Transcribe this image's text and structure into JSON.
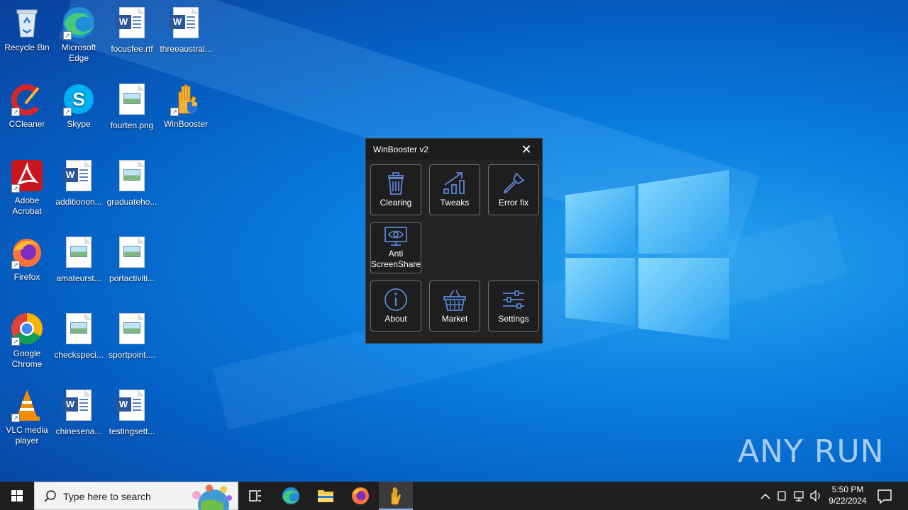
{
  "desktop_icons": [
    {
      "label": "Recycle Bin"
    },
    {
      "label": "Microsoft Edge"
    },
    {
      "label": "focusfee.rtf"
    },
    {
      "label": "threeaustral..."
    },
    {
      "label": "CCleaner"
    },
    {
      "label": "Skype"
    },
    {
      "label": "fourten.png"
    },
    {
      "label": "WinBooster"
    },
    {
      "label": "Adobe Acrobat"
    },
    {
      "label": "additionon..."
    },
    {
      "label": "graduateho..."
    },
    {
      "label": "Firefox"
    },
    {
      "label": "amateurst..."
    },
    {
      "label": "portactiviti..."
    },
    {
      "label": "Google Chrome"
    },
    {
      "label": "checkspeci..."
    },
    {
      "label": "sportpoint...."
    },
    {
      "label": "VLC media player"
    },
    {
      "label": "chinesena..."
    },
    {
      "label": "testingsett..."
    }
  ],
  "app_window": {
    "title": "WinBooster v2",
    "close_glyph": "✕",
    "tiles": [
      {
        "label": "Clearing",
        "icon": "trash-icon"
      },
      {
        "label": "Tweaks",
        "icon": "chart-arrow-icon"
      },
      {
        "label": "Error fix",
        "icon": "screwdriver-icon"
      },
      {
        "label": "Anti ScreenShare",
        "icon": "eye-monitor-icon"
      },
      {
        "label": "About",
        "icon": "info-icon"
      },
      {
        "label": "Market",
        "icon": "basket-icon"
      },
      {
        "label": "Settings",
        "icon": "sliders-icon"
      }
    ]
  },
  "watermark": "ANY RUN",
  "taskbar": {
    "search_placeholder": "Type here to search",
    "time": "5:50 PM",
    "date": "9/22/2024"
  },
  "colors": {
    "taskbar_bg": "#1f1f1f",
    "window_bg": "#232323",
    "accent": "#0a7fe0"
  }
}
